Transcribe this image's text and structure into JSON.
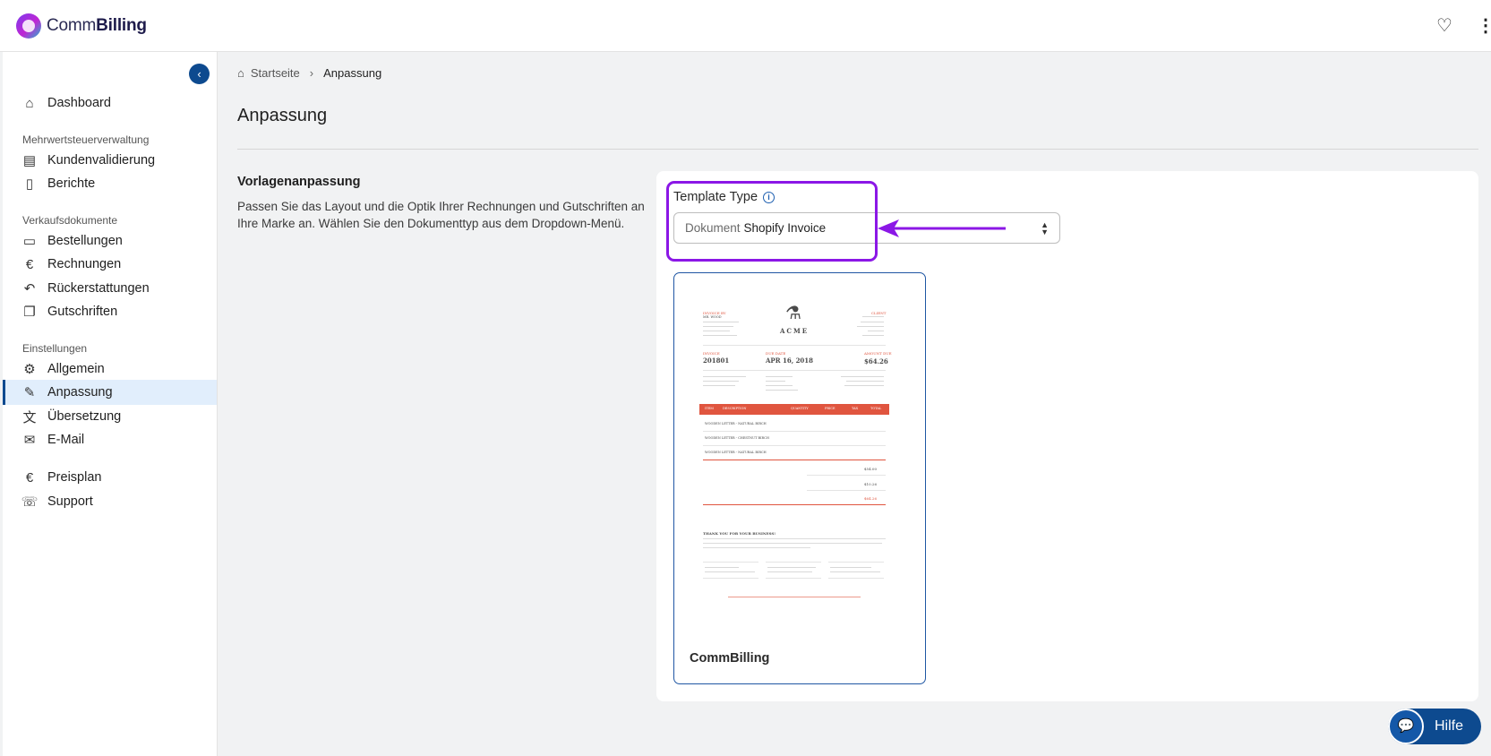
{
  "app": {
    "logo_light": "Comm",
    "logo_bold": "Billing"
  },
  "sidebar": {
    "dashboard": "Dashboard",
    "section_vat": "Mehrwertsteuerverwaltung",
    "kundenvalidierung": "Kundenvalidierung",
    "berichte": "Berichte",
    "section_sales": "Verkaufsdokumente",
    "bestellungen": "Bestellungen",
    "rechnungen": "Rechnungen",
    "rueckerstattungen": "Rückerstattungen",
    "gutschriften": "Gutschriften",
    "section_settings": "Einstellungen",
    "allgemein": "Allgemein",
    "anpassung": "Anpassung",
    "uebersetzung": "Übersetzung",
    "email": "E-Mail",
    "preisplan": "Preisplan",
    "support": "Support"
  },
  "breadcrumb": {
    "home": "Startseite",
    "current": "Anpassung"
  },
  "page": {
    "title": "Anpassung"
  },
  "section": {
    "title": "Vorlagenanpassung",
    "description": "Passen Sie das Layout und die Optik Ihrer Rechnungen und Gutschriften an Ihre Marke an. Wählen Sie den Dokumenttyp aus dem Dropdown-Menü."
  },
  "template_type": {
    "label": "Template Type",
    "select_prefix": "Dokument",
    "select_value": "Shopify Invoice"
  },
  "template_card": {
    "name": "CommBilling",
    "invoice": {
      "brand": "ACME",
      "invoice_no": "201801",
      "date": "APR 16, 2018",
      "amount": "$64.26",
      "header_cols": [
        "ITEM",
        "DESCRIPTION",
        "QUANTITY",
        "PRICE",
        "TAX",
        "TOTAL"
      ],
      "items": [
        "WOODEN LETTER - NATURAL BIRCH",
        "WOODEN LETTER - CHESTNUT BIRCH",
        "WOODEN LETTER - NATURAL BIRCH"
      ],
      "thanks": "THANK YOU FOR YOUR BUSINESS!",
      "subtotal": "$54.00",
      "vat": "$10.26",
      "due": "$64.26"
    }
  },
  "help": {
    "label": "Hilfe"
  },
  "colors": {
    "accent": "#0d4a8f",
    "highlight": "#8b17e6",
    "invoice_red": "#e0553f"
  }
}
